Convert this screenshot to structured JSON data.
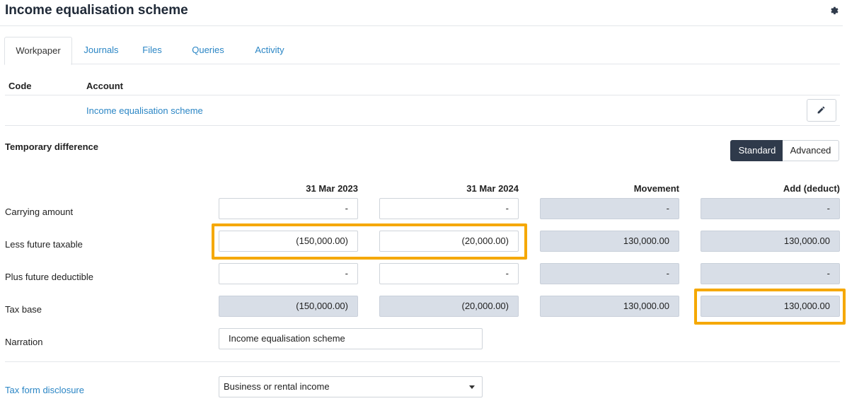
{
  "page": {
    "title": "Income equalisation scheme"
  },
  "tabs": [
    "Workpaper",
    "Journals",
    "Files",
    "Queries",
    "Activity"
  ],
  "account_table": {
    "headers": {
      "code": "Code",
      "account": "Account"
    },
    "row": {
      "code": "",
      "account": "Income equalisation scheme"
    }
  },
  "section": {
    "title": "Temporary difference",
    "toggle": {
      "standard": "Standard",
      "advanced": "Advanced",
      "selected": "Standard"
    }
  },
  "grid": {
    "columns": [
      "31 Mar 2023",
      "31 Mar 2024",
      "Movement",
      "Add (deduct)"
    ],
    "rows": [
      {
        "label": "Carrying amount",
        "values": [
          "-",
          "-",
          "-",
          "-"
        ]
      },
      {
        "label": "Less future taxable",
        "values": [
          "(150,000.00)",
          "(20,000.00)",
          "130,000.00",
          "130,000.00"
        ]
      },
      {
        "label": "Plus future deductible",
        "values": [
          "-",
          "-",
          "-",
          "-"
        ]
      },
      {
        "label": "Tax base",
        "values": [
          "(150,000.00)",
          "(20,000.00)",
          "130,000.00",
          "130,000.00"
        ]
      }
    ]
  },
  "narration": {
    "label": "Narration",
    "value": "Income equalisation scheme"
  },
  "disclosure": {
    "label": "Tax form disclosure",
    "value": "Business or rental income"
  },
  "colors": {
    "accent": "#2b86c5",
    "highlight": "#f5a800",
    "toggle_active": "#2f3a4b",
    "readonly_fill": "#d8dee7"
  }
}
